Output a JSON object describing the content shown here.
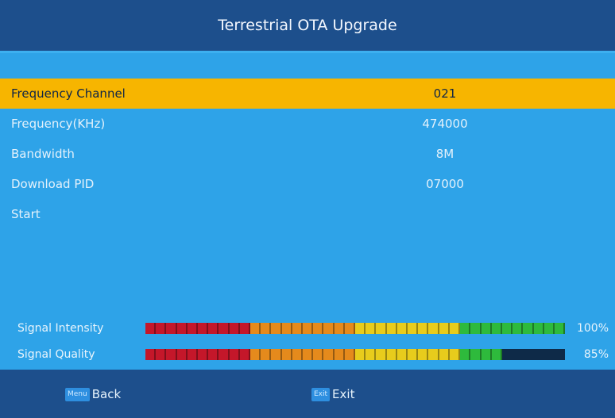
{
  "header": {
    "title": "Terrestrial OTA Upgrade"
  },
  "menu": {
    "items": [
      {
        "label": "Frequency Channel",
        "value": "021",
        "selected": true
      },
      {
        "label": "Frequency(KHz)",
        "value": "474000",
        "selected": false
      },
      {
        "label": "Bandwidth",
        "value": "8M",
        "selected": false
      },
      {
        "label": "Download PID",
        "value": "07000",
        "selected": false
      },
      {
        "label": "Start",
        "value": "",
        "selected": false
      }
    ]
  },
  "signal": {
    "intensity": {
      "label": "Signal Intensity",
      "percent_text": "100%",
      "level": 1.0
    },
    "quality": {
      "label": "Signal Quality",
      "percent_text": "85%",
      "level": 0.85
    },
    "colors": {
      "red": "#c4172a",
      "orange": "#e58a1c",
      "yellow": "#e8cc1c",
      "green": "#2eba3c",
      "empty": "#0e2a48"
    }
  },
  "footer": {
    "back": {
      "key": "Menu",
      "label": "Back"
    },
    "exit": {
      "key": "Exit",
      "label": "Exit"
    }
  },
  "colors": {
    "background": "#2ea3e8",
    "header": "#1d4f8c",
    "highlight": "#f7b500"
  }
}
